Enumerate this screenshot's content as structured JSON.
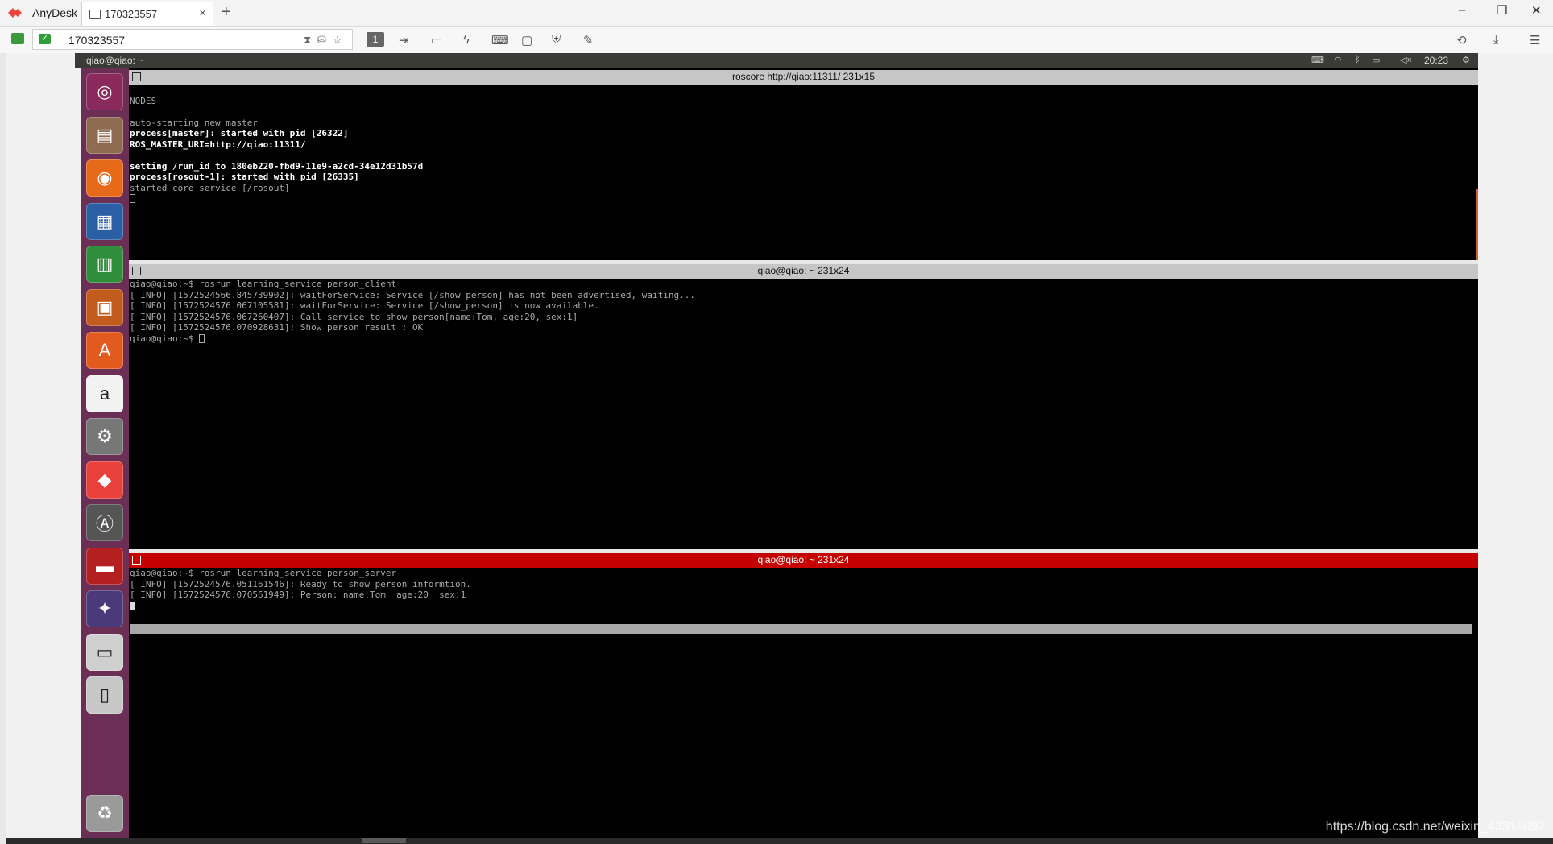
{
  "anydesk": {
    "app_name": "AnyDesk",
    "tab_label": "170323557",
    "tab_close": "×",
    "tab_add": "+",
    "window_buttons": {
      "minimize": "–",
      "restore": "❐",
      "close": "✕"
    },
    "address_value": "170323557",
    "monitor_number": "1",
    "brand_color": "#ef443b"
  },
  "remote": {
    "panel_title": "qiao@qiao: ~",
    "clock": "20:23",
    "launcher_icons": [
      "ubuntu-dash-icon",
      "files-icon",
      "firefox-icon",
      "writer-icon",
      "calc-icon",
      "impress-icon",
      "software-center-icon",
      "amazon-icon",
      "system-settings-icon",
      "anydesk-launcher-icon",
      "software-updater-icon",
      "terminator-icon",
      "rviz-icon",
      "drive-icon",
      "usb-drive-icon",
      "trash-icon"
    ],
    "terminals": [
      {
        "title": "roscore http://qiao:11311/ 231x15",
        "lines": [
          {
            "text": "",
            "bold": false
          },
          {
            "text": "NODES",
            "bold": false
          },
          {
            "text": "",
            "bold": false
          },
          {
            "text": "auto-starting new master",
            "bold": false
          },
          {
            "text": "process[master]: started with pid [26322]",
            "bold": true
          },
          {
            "text": "ROS_MASTER_URI=http://qiao:11311/",
            "bold": true
          },
          {
            "text": "",
            "bold": false
          },
          {
            "text": "setting /run_id to 180eb220-fbd9-11e9-a2cd-34e12d31b57d",
            "bold": true
          },
          {
            "text": "process[rosout-1]: started with pid [26335]",
            "bold": true
          },
          {
            "text": "started core service [/rosout]",
            "bold": false
          }
        ]
      },
      {
        "title": "qiao@qiao: ~ 231x24",
        "lines": [
          {
            "text": "qiao@qiao:~$ rosrun learning_service person_client",
            "bold": false
          },
          {
            "text": "[ INFO] [1572524566.845739902]: waitForService: Service [/show_person] has not been advertised, waiting...",
            "bold": false
          },
          {
            "text": "[ INFO] [1572524576.067105581]: waitForService: Service [/show_person] is now available.",
            "bold": false
          },
          {
            "text": "[ INFO] [1572524576.067260407]: Call service to show person[name:Tom, age:20, sex:1]",
            "bold": false
          },
          {
            "text": "[ INFO] [1572524576.070928631]: Show person result : OK",
            "bold": false
          },
          {
            "text": "qiao@qiao:~$ ",
            "bold": false
          }
        ]
      },
      {
        "title": "qiao@qiao: ~ 231x24",
        "lines": [
          {
            "text": "qiao@qiao:~$ rosrun learning_service person_server",
            "bold": false
          },
          {
            "text": "[ INFO] [1572524576.051161546]: Ready to show person informtion.",
            "bold": false
          },
          {
            "text": "[ INFO] [1572524576.070561949]: Person: name:Tom  age:20  sex:1",
            "bold": false
          }
        ]
      }
    ]
  },
  "watermark": "https://blog.csdn.net/weixin_43313092"
}
